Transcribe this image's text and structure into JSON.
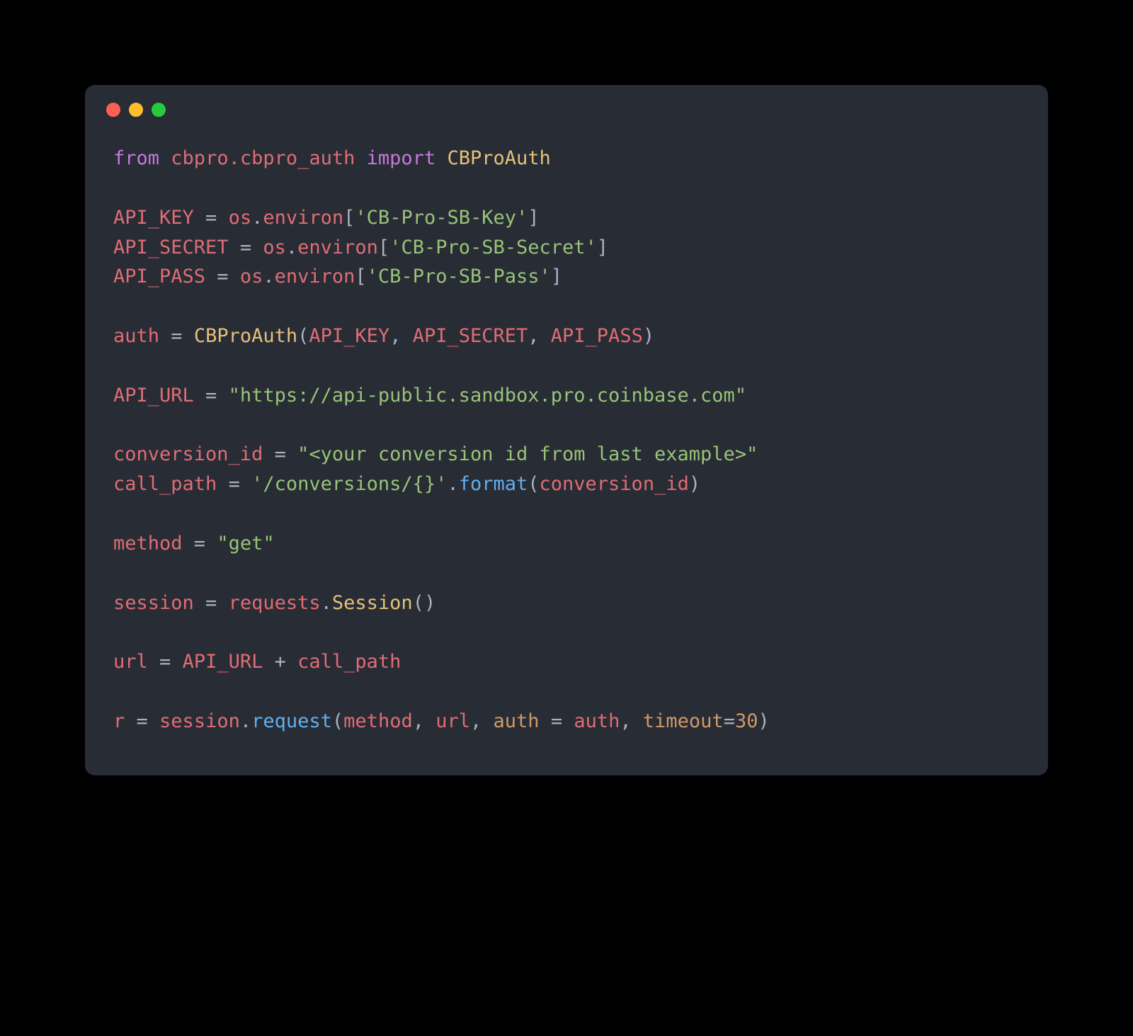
{
  "code": {
    "l1": {
      "from": "from",
      "mod": "cbpro.cbpro_auth",
      "import": "import",
      "cls": "CBProAuth"
    },
    "l3": {
      "var": "API_KEY",
      "eq": " = ",
      "obj": "os",
      "dot": ".",
      "prop": "environ",
      "lbr": "[",
      "str": "'CB-Pro-SB-Key'",
      "rbr": "]"
    },
    "l4": {
      "var": "API_SECRET",
      "eq": " = ",
      "obj": "os",
      "dot": ".",
      "prop": "environ",
      "lbr": "[",
      "str": "'CB-Pro-SB-Secret'",
      "rbr": "]"
    },
    "l5": {
      "var": "API_PASS",
      "eq": " = ",
      "obj": "os",
      "dot": ".",
      "prop": "environ",
      "lbr": "[",
      "str": "'CB-Pro-SB-Pass'",
      "rbr": "]"
    },
    "l7": {
      "var": "auth",
      "eq": " = ",
      "cls": "CBProAuth",
      "lp": "(",
      "a1": "API_KEY",
      "c1": ", ",
      "a2": "API_SECRET",
      "c2": ", ",
      "a3": "API_PASS",
      "rp": ")"
    },
    "l9": {
      "var": "API_URL",
      "eq": " = ",
      "str": "\"https://api-public.sandbox.pro.coinbase.com\""
    },
    "l11": {
      "var": "conversion_id",
      "eq": " = ",
      "str": "\"<your conversion id from last example>\""
    },
    "l12": {
      "var": "call_path",
      "eq": " = ",
      "str": "'/conversions/{}'",
      "dot": ".",
      "fn": "format",
      "lp": "(",
      "arg": "conversion_id",
      "rp": ")"
    },
    "l14": {
      "var": "method",
      "eq": " = ",
      "str": "\"get\""
    },
    "l16": {
      "var": "session",
      "eq": " = ",
      "obj": "requests",
      "dot": ".",
      "fn": "Session",
      "paren": "()"
    },
    "l18": {
      "var": "url",
      "eq": " = ",
      "a1": "API_URL",
      "plus": " + ",
      "a2": "call_path"
    },
    "l20": {
      "var": "r",
      "eq": " = ",
      "obj": "session",
      "dot": ".",
      "fn": "request",
      "lp": "(",
      "a1": "method",
      "c1": ", ",
      "a2": "url",
      "c2": ", ",
      "p1": "auth",
      "eq2": " = ",
      "v1": "auth",
      "c3": ", ",
      "p2": "timeout",
      "eq3": "=",
      "num": "30",
      "rp": ")"
    }
  }
}
